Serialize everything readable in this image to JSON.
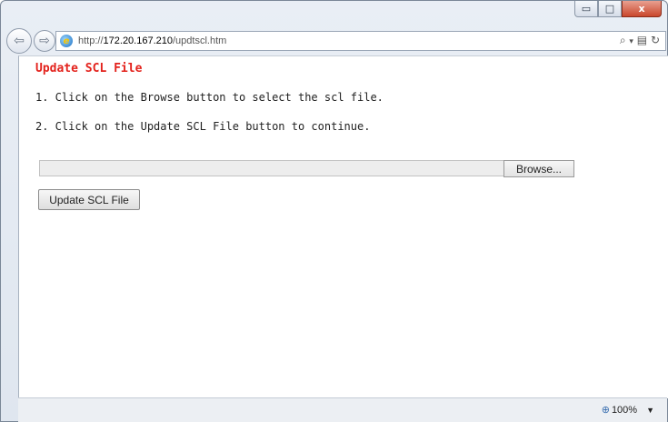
{
  "browser": {
    "url_prefix": "http://",
    "url_host": "172.20.167.210",
    "url_path": "/updtscl.htm",
    "zoom_level": "100%",
    "icons": {
      "back": "back-arrow-icon",
      "forward": "forward-arrow-icon",
      "search": "search-icon",
      "compat": "compatibility-view-icon",
      "refresh": "refresh-icon"
    }
  },
  "window_controls": {
    "minimize": "▭",
    "maximize": "□",
    "close": "x"
  },
  "page": {
    "title": "Update SCL File",
    "step1": "1. Click on the Browse button to select the scl file.",
    "step2": "2. Click on the Update SCL File button to continue.",
    "browse_label": "Browse...",
    "file_value": "",
    "update_label": "Update SCL File"
  },
  "colors": {
    "title": "#e3211b"
  }
}
